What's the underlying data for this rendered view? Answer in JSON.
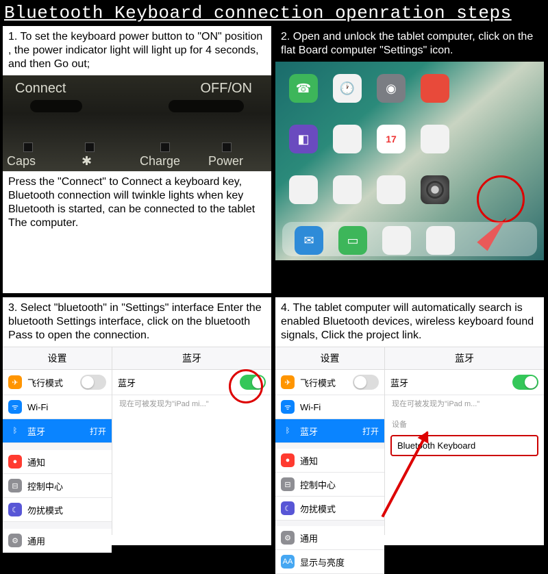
{
  "title": "Bluetooth Keyboard connection openration steps",
  "step1": {
    "text_a": "1. To set the keyboard power button to \"ON\" position , the power indicator light will light up for 4 seconds, and then Go out;",
    "text_b": "Press the \"Connect\" to Connect a keyboard key, Bluetooth connection will twinkle lights when key Bluetooth is started, can be connected to the tablet The computer.",
    "hw": {
      "connect": "Connect",
      "offon": "OFF/ON",
      "caps": "Caps",
      "bt": "✱",
      "charge": "Charge",
      "power": "Power"
    }
  },
  "step2": {
    "text": "2. Open and unlock the tablet computer, click on the flat Board computer \"Settings\" icon.",
    "cal_day": "17"
  },
  "step3": {
    "text": "3. Select \"bluetooth\" in \"Settings\" interface Enter the bluetooth Settings interface, click on the bluetooth Pass to open the connection.",
    "left_header": "设置",
    "right_header": "蓝牙",
    "rows": {
      "airplane": "飞行模式",
      "wifi": "Wi-Fi",
      "bluetooth": "蓝牙",
      "bt_status": "打开",
      "notify": "通知",
      "control": "控制中心",
      "dnd": "勿扰模式",
      "general": "通用"
    },
    "bt_label": "蓝牙",
    "discoverable": "现在可被发现为\"iPad mi...\""
  },
  "step4": {
    "text": "4. The tablet computer will automatically search is enabled Bluetooth devices, wireless keyboard found signals, Click the project link.",
    "left_header": "设置",
    "right_header": "蓝牙",
    "rows": {
      "airplane": "飞行模式",
      "wifi": "Wi-Fi",
      "bluetooth": "蓝牙",
      "bt_status": "打开",
      "notify": "通知",
      "control": "控制中心",
      "dnd": "勿扰模式",
      "general": "通用",
      "display": "显示与亮度"
    },
    "bt_label": "蓝牙",
    "discoverable": "现在可被发现为\"iPad m...\"",
    "devices_label": "设备",
    "device_name": "Bluetooth Keyboard"
  }
}
